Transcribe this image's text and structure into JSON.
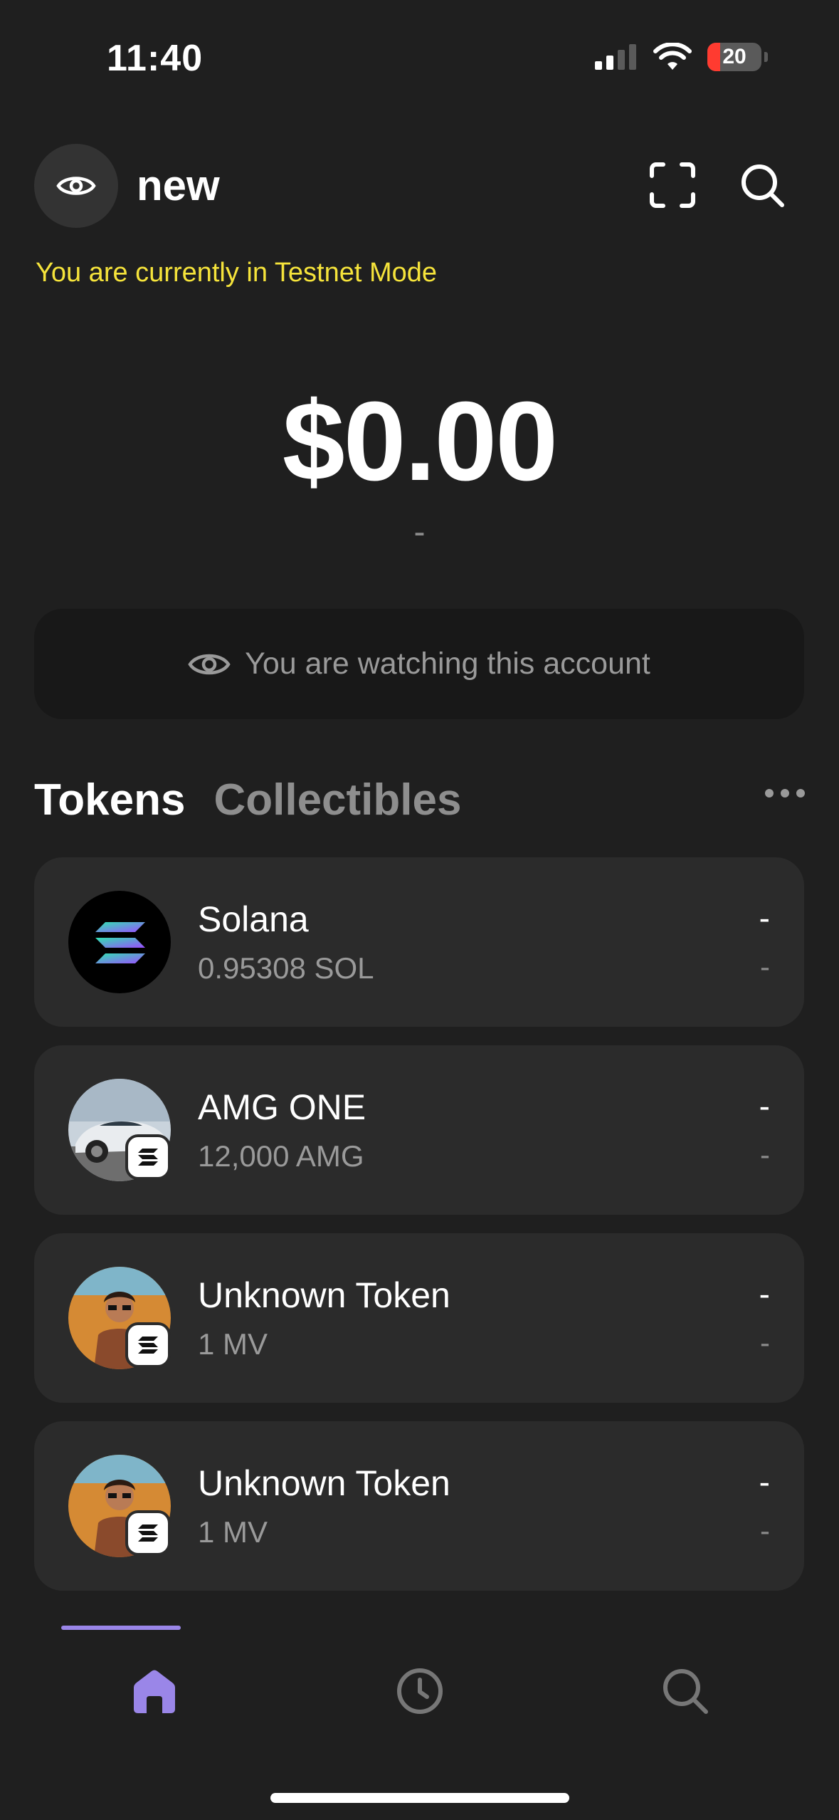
{
  "status_bar": {
    "time": "11:40",
    "battery": "20"
  },
  "header": {
    "account_name": "new",
    "account_icon": "eye-icon",
    "scan_icon": "scan-icon",
    "search_icon": "search-icon"
  },
  "testnet_notice": "You are currently in Testnet Mode",
  "balance": {
    "amount": "$0.00",
    "change": "-"
  },
  "watch_banner": {
    "text": "You are watching this account",
    "icon": "eye-icon"
  },
  "tabs": {
    "tokens": "Tokens",
    "collectibles": "Collectibles",
    "active": "Tokens"
  },
  "tokens": [
    {
      "name": "Solana",
      "amount": "0.95308 SOL",
      "value": "-",
      "change": "-"
    },
    {
      "name": "AMG ONE",
      "amount": "12,000 AMG",
      "value": "-",
      "change": "-"
    },
    {
      "name": "Unknown Token",
      "amount": "1 MV",
      "value": "-",
      "change": "-"
    },
    {
      "name": "Unknown Token",
      "amount": "1 MV",
      "value": "-",
      "change": "-"
    }
  ],
  "bottom_nav": {
    "items": [
      "home",
      "history",
      "search"
    ],
    "active": "home"
  },
  "colors": {
    "background": "#1f1f1f",
    "card": "#2b2b2b",
    "testnet": "#f5e33b",
    "accent": "#9a86e8"
  }
}
